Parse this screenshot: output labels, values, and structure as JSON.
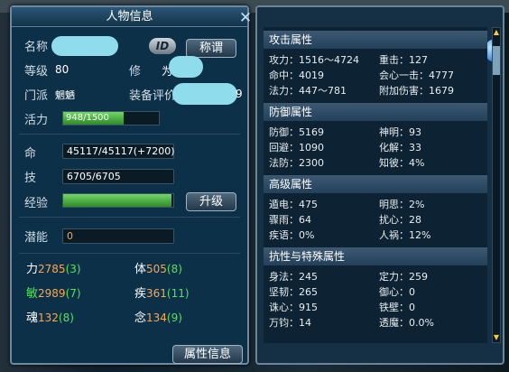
{
  "left": {
    "title": "人物信息",
    "name_label": "名称",
    "id_badge": "ID",
    "title_btn": "称谓",
    "level_label": "等级",
    "level_value": "80",
    "cultivation_label": "修",
    "cultivation_value": "为",
    "sect_label": "门派",
    "sect_value": "魍魉",
    "gear_label": "装备评价",
    "gear_tail": "9",
    "vitality_label": "活力",
    "vitality_text": "948/1500",
    "vitality_fraction": 0.632,
    "hp_label": "命",
    "hp_value": "45117/45117(+7200)",
    "mp_label": "技",
    "mp_value": "6705/6705",
    "exp_label": "经验",
    "exp_fraction": 0.98,
    "upgrade_btn": "升级",
    "potential_label": "潜能",
    "potential_value": "0",
    "stats": [
      {
        "name": "力",
        "value": "2785",
        "add": "(3)",
        "name_color": "#ffffff"
      },
      {
        "name": "体",
        "value": "505",
        "add": "(8)",
        "name_color": "#ffffff"
      },
      {
        "name": "敏",
        "value": "2989",
        "add": "(7)",
        "name_color": "#52e552"
      },
      {
        "name": "疾",
        "value": "361",
        "add": "(11)",
        "name_color": "#ffffff"
      },
      {
        "name": "魂",
        "value": "132",
        "add": "(8)",
        "name_color": "#ffffff"
      },
      {
        "name": "念",
        "value": "134",
        "add": "(9)",
        "name_color": "#ffffff"
      }
    ],
    "attr_btn": "属性信息"
  },
  "right": {
    "sections": [
      {
        "title": "攻击属性",
        "rows": [
          [
            "攻力：1516～4724",
            "重击：127"
          ],
          [
            "命中：4019",
            "会心一击：4777"
          ],
          [
            "法力：447～781",
            "附加伤害：1679"
          ]
        ]
      },
      {
        "title": "防御属性",
        "rows": [
          [
            "防御：5169",
            "神明：93"
          ],
          [
            "回避：1090",
            "化解：33"
          ],
          [
            "法防：2300",
            "知彼：4%"
          ]
        ]
      },
      {
        "title": "高级属性",
        "rows": [
          [
            "遁电：475",
            "明思：2%"
          ],
          [
            "骤雨：64",
            "扰心：28"
          ],
          [
            "疾语：0%",
            "人祸：12%"
          ]
        ]
      },
      {
        "title": "抗性与特殊属性",
        "rows": [
          [
            "身法：245",
            "定力：259"
          ],
          [
            "坚韧：265",
            "御心：0"
          ],
          [
            "诛心：915",
            "铁壁：0"
          ],
          [
            "万钧：14",
            "透魔：0.0%"
          ]
        ]
      }
    ]
  }
}
